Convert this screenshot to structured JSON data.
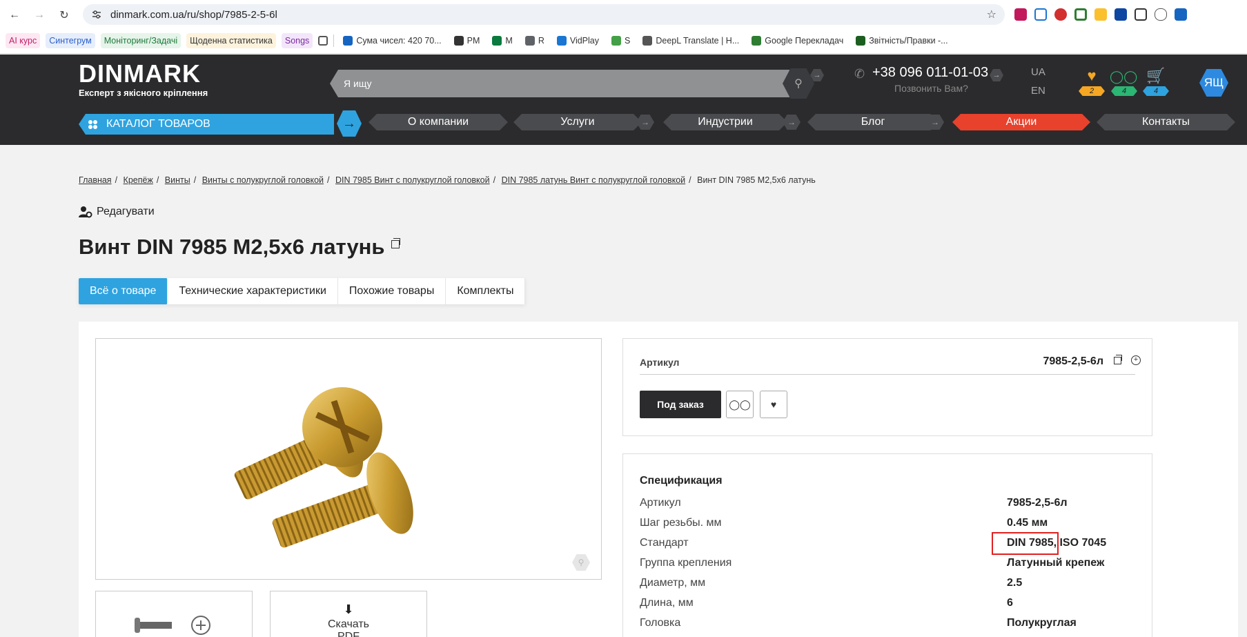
{
  "browser": {
    "url": "dinmark.com.ua/ru/shop/7985-2-5-6l",
    "bookmarks": [
      {
        "label": "AI курс",
        "bg": "#fde7f2",
        "color": "#c0206a"
      },
      {
        "label": "Синтегрум",
        "bg": "#e6eefc",
        "color": "#2a5fc9"
      },
      {
        "label": "Моніторинг/Задачі",
        "bg": "#e6f4ea",
        "color": "#1e7a3a"
      },
      {
        "label": "Щоденна статистика",
        "bg": "#fdf3dd",
        "color": "#333"
      },
      {
        "label": "Songs",
        "bg": "#f3e6fa",
        "color": "#7a2aa0"
      },
      {
        "label": "Сума чисел: 420 70...",
        "bg": "transparent",
        "color": "#333"
      },
      {
        "label": "PM",
        "bg": "transparent",
        "color": "#333"
      },
      {
        "label": "M",
        "bg": "transparent",
        "color": "#333"
      },
      {
        "label": "R",
        "bg": "transparent",
        "color": "#333"
      },
      {
        "label": "VidPlay",
        "bg": "transparent",
        "color": "#333"
      },
      {
        "label": "S",
        "bg": "transparent",
        "color": "#333"
      },
      {
        "label": "DeepL Translate | H...",
        "bg": "transparent",
        "color": "#333"
      },
      {
        "label": "Google Перекладач",
        "bg": "transparent",
        "color": "#333"
      },
      {
        "label": "Звітність/Правки -...",
        "bg": "transparent",
        "color": "#333"
      }
    ]
  },
  "header": {
    "logo": "DINMARK",
    "tagline": "Експерт з якісного кріплення",
    "search_placeholder": "Я ищу",
    "phone": "+38 096 011-01-03",
    "callback": "Позвонить Вам?",
    "lang_ua": "UA",
    "lang_en": "EN",
    "favorites_count": "2",
    "compare_count": "4",
    "cart_count": "4",
    "avatar": "ЯЩ",
    "catalog": "КАТАЛОГ ТОВАРОВ",
    "menu": {
      "about": "О компании",
      "services": "Услуги",
      "industries": "Индустрии",
      "blog": "Блог",
      "promo": "Акции",
      "contacts": "Контакты"
    }
  },
  "breadcrumb": {
    "items": [
      "Главная",
      "Крепёж",
      "Винты",
      "Винты с полукруглой головкой",
      "DIN 7985 Винт с полукруглой головкой",
      "DIN 7985 латунь Винт с полукруглой головкой"
    ],
    "current": "Винт DIN 7985 M2,5x6 латунь"
  },
  "edit_label": "Редагувати",
  "product": {
    "title": "Винт DIN 7985 M2,5x6 латунь",
    "tabs": [
      "Всё о товаре",
      "Технические характеристики",
      "Похожие товары",
      "Комплекты"
    ],
    "sku_label": "Артикул",
    "sku": "7985-2,5-6л",
    "order_button": "Под заказ",
    "download_label": "Скачать",
    "download_label2": "PDF"
  },
  "spec": {
    "title": "Спецификация",
    "rows": [
      {
        "k": "Артикул",
        "v": "7985-2,5-6л"
      },
      {
        "k": "Шаг резьбы. мм",
        "v": "0.45 мм"
      },
      {
        "k": "Стандарт",
        "v": "DIN 7985, ISO 7045"
      },
      {
        "k": "Группа крепления",
        "v": "Латунный крепеж"
      },
      {
        "k": "Диаметр, мм",
        "v": "2.5"
      },
      {
        "k": "Длина, мм",
        "v": "6"
      },
      {
        "k": "Головка",
        "v": "Полукруглая"
      }
    ]
  },
  "colors": {
    "brand_blue": "#2ea3e0",
    "header_dark": "#2b2b2d",
    "promo_red": "#e8412c",
    "highlight_red": "#e02020"
  }
}
